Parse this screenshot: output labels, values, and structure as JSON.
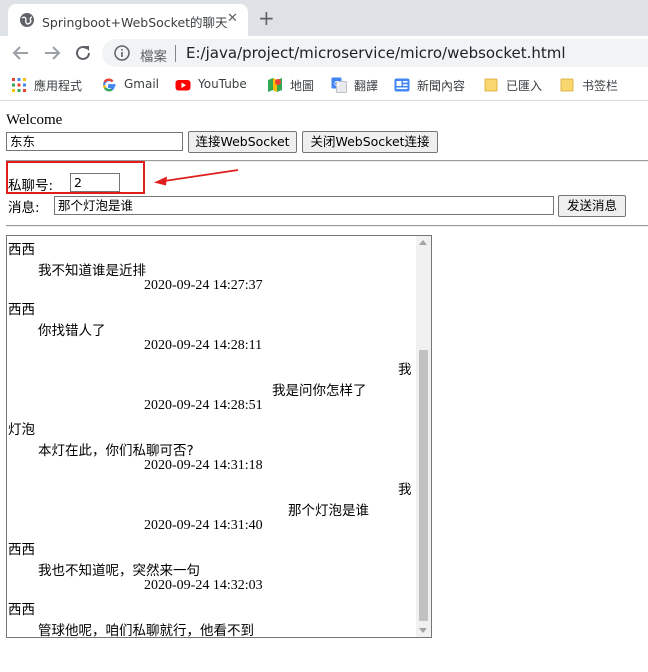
{
  "browser": {
    "tab_title": "Springboot+WebSocket的聊天",
    "tab_close": "✕",
    "new_tab": "+",
    "secure_label": "檔案",
    "url": "E:/java/project/microservice/micro/websocket.html",
    "bookmarks": [
      {
        "label": "應用程式",
        "icon": "apps-grid-icon"
      },
      {
        "label": "Gmail",
        "icon": "google-icon"
      },
      {
        "label": "YouTube",
        "icon": "youtube-icon"
      },
      {
        "label": "地圖",
        "icon": "maps-icon"
      },
      {
        "label": "翻譯",
        "icon": "translate-icon"
      },
      {
        "label": "新聞內容",
        "icon": "news-icon"
      },
      {
        "label": "已匯入",
        "icon": "folder-icon"
      },
      {
        "label": "书签栏",
        "icon": "folder-icon"
      }
    ]
  },
  "page": {
    "welcome": "Welcome",
    "username_value": "东东",
    "connect_label": "连接WebSocket",
    "disconnect_label": "关闭WebSocket连接",
    "private_label": "私聊号:",
    "private_value": "2",
    "message_label": "消息:",
    "message_value": "那个灯泡是谁",
    "send_label": "发送消息"
  },
  "messages": {
    "m1": {
      "sender": "西西",
      "text": "我不知道谁是近排",
      "time": "2020-09-24 14:27:37"
    },
    "m2": {
      "sender": "西西",
      "text": "你找错人了",
      "time": "2020-09-24 14:28:11"
    },
    "m3": {
      "sender": "我",
      "text": "我是问你怎样了",
      "time": "2020-09-24 14:28:51"
    },
    "m4": {
      "sender": "灯泡",
      "text": "本灯在此，你们私聊可否?",
      "time": "2020-09-24 14:31:18"
    },
    "m5": {
      "sender": "我",
      "text": "那个灯泡是谁",
      "time": "2020-09-24 14:31:40"
    },
    "m6": {
      "sender": "西西",
      "text": "我也不知道呢，突然来一句",
      "time": "2020-09-24 14:32:03"
    },
    "m7": {
      "sender": "西西",
      "text": "管球他呢，咱们私聊就行，他看不到"
    }
  },
  "colors": {
    "annotation_red": "#e01e1e",
    "chrome_tabbar": "#dee1e6",
    "omnibox": "#f1f3f4"
  }
}
